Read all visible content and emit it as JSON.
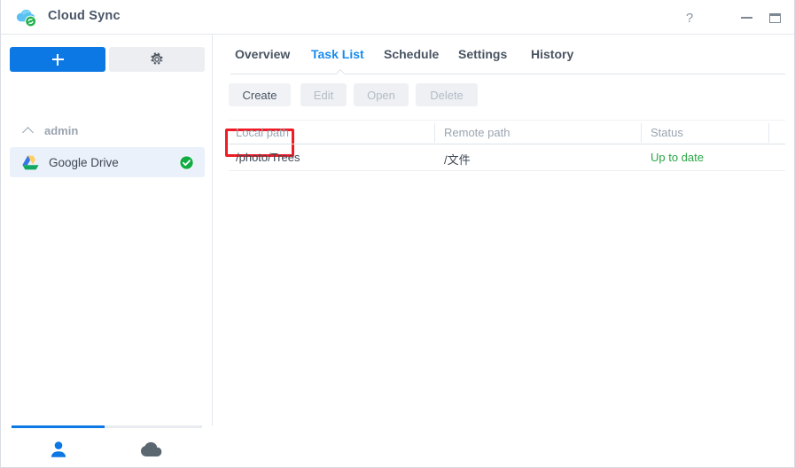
{
  "window": {
    "title": "Cloud Sync",
    "app_icon": "cloud-sync-icon",
    "controls": {
      "help": "?",
      "minimize": "minimize-icon",
      "maximize": "maximize-icon",
      "close": "close-icon"
    }
  },
  "sidebar": {
    "add_button": "+",
    "settings_button": "gear-icon",
    "group": {
      "label": "admin",
      "chevron": "chevron-up-icon",
      "expanded": true
    },
    "connections": [
      {
        "label": "Google Drive",
        "icon": "google-drive-icon",
        "status_badge": "check-circle-icon",
        "selected": true
      }
    ],
    "bottom_nav": [
      {
        "icon": "user-icon",
        "active": true
      },
      {
        "icon": "cloud-icon",
        "active": false
      }
    ]
  },
  "main": {
    "tabs": [
      {
        "label": "Overview",
        "active": false
      },
      {
        "label": "Task List",
        "active": true
      },
      {
        "label": "Schedule",
        "active": false
      },
      {
        "label": "Settings",
        "active": false
      },
      {
        "label": "History",
        "active": false
      }
    ],
    "toolbar": [
      {
        "label": "Create",
        "enabled": true,
        "highlighted": true
      },
      {
        "label": "Edit",
        "enabled": false,
        "highlighted": false
      },
      {
        "label": "Open",
        "enabled": false,
        "highlighted": false
      },
      {
        "label": "Delete",
        "enabled": false,
        "highlighted": false
      }
    ],
    "table": {
      "columns": [
        "Local path",
        "Remote path",
        "Status"
      ],
      "rows": [
        {
          "local_path": "/photo/Trees",
          "remote_path": "/文件",
          "status": "Up to date"
        }
      ]
    }
  },
  "colors": {
    "accent": "#0b78e3",
    "tab_active": "#1a8cf0",
    "status_ok": "#2aa744",
    "highlight": "#ee1c25",
    "selected_row": "#eaf1fb"
  }
}
